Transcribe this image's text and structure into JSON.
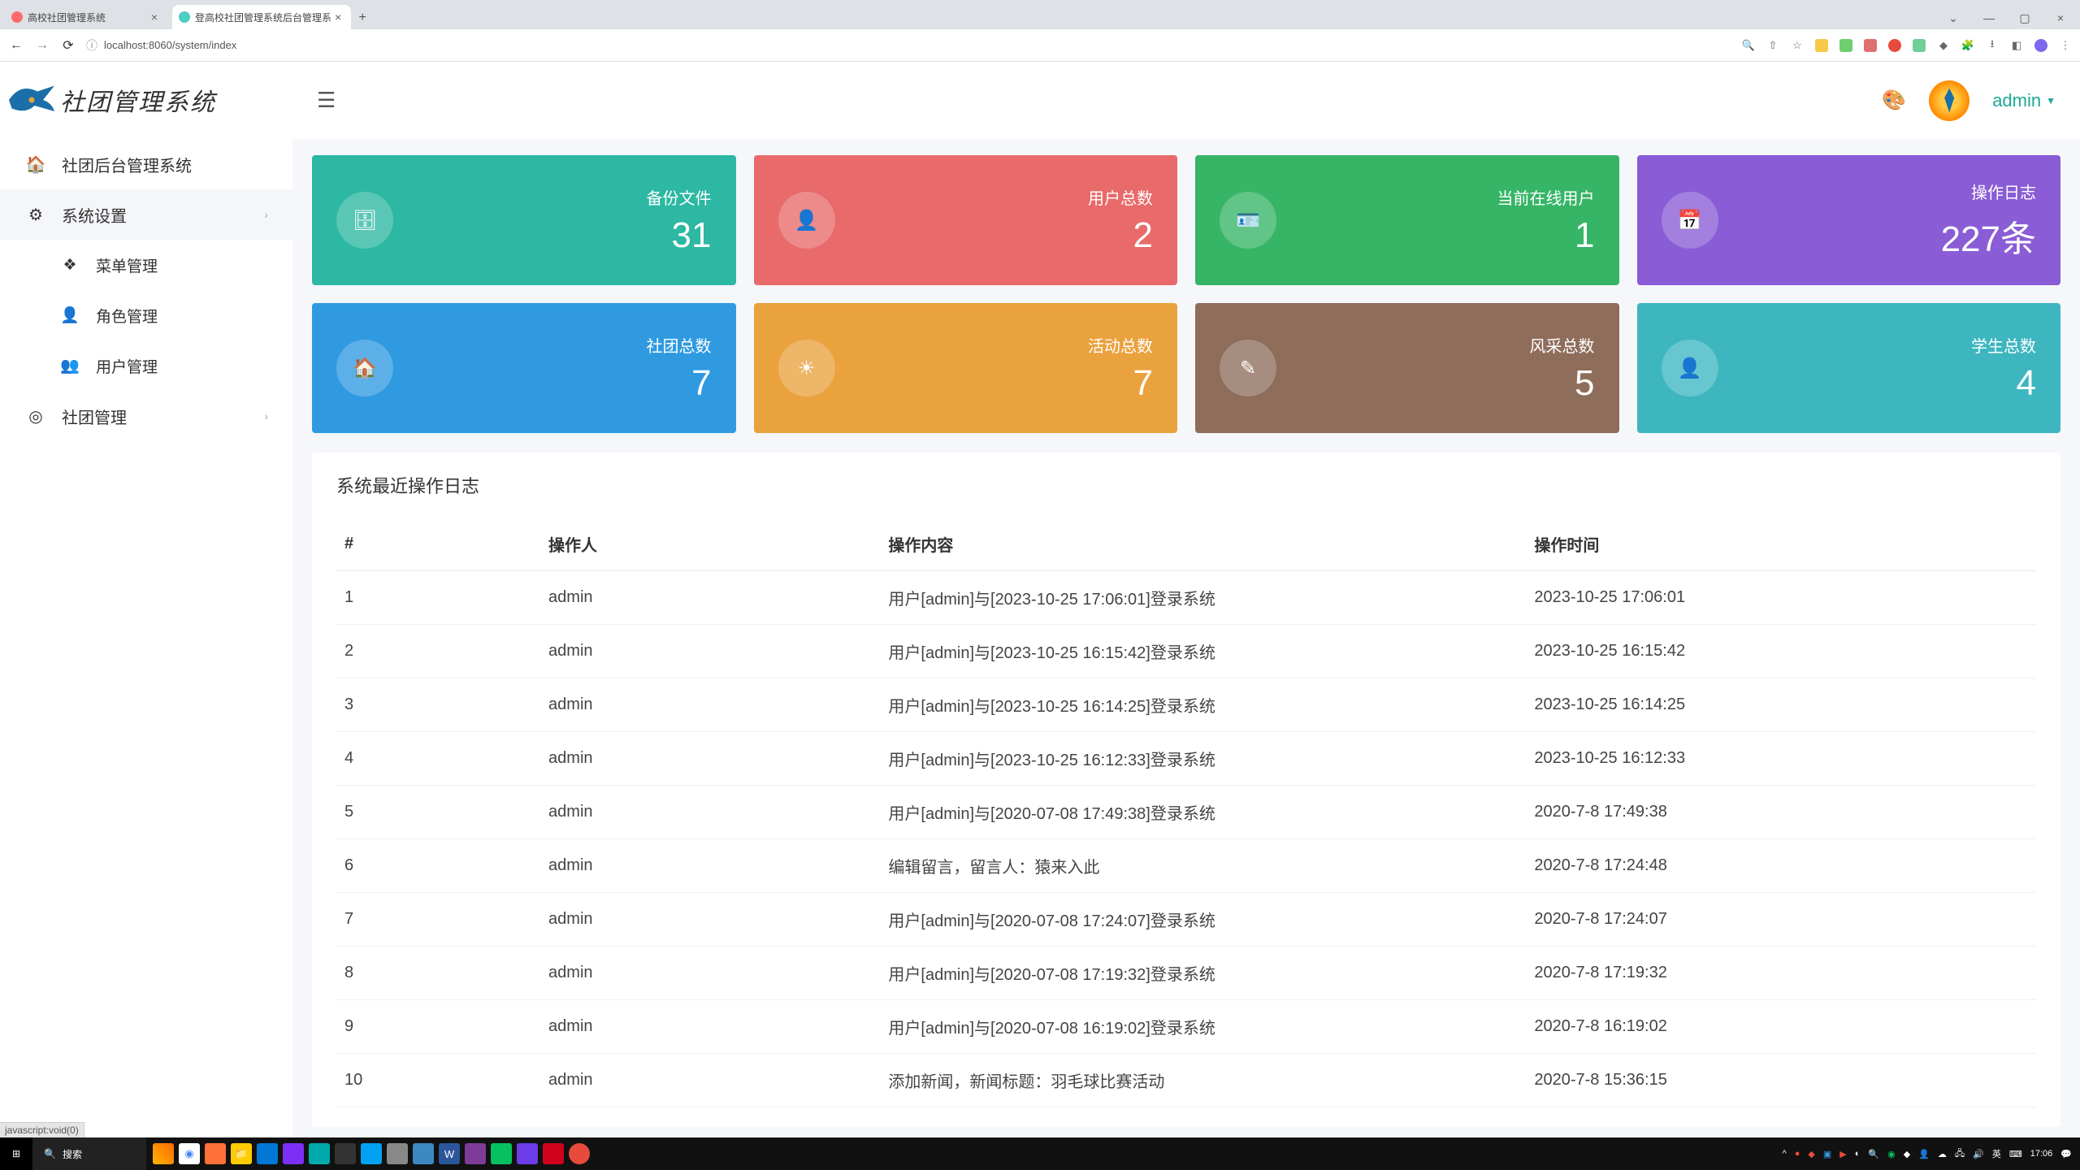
{
  "browser": {
    "tabs": [
      {
        "title": "高校社团管理系统"
      },
      {
        "title": "登高校社团管理系统后台管理系"
      }
    ],
    "url": "localhost:8060/system/index",
    "status_hint": "javascript:void(0)"
  },
  "app": {
    "logo_text": "社团管理系统",
    "hamburger_title": "menu",
    "username": "admin"
  },
  "sidebar": {
    "items": [
      {
        "icon": "home",
        "label": "社团后台管理系统"
      },
      {
        "icon": "gear",
        "label": "系统设置",
        "expandable": true
      },
      {
        "icon": "layers",
        "label": "菜单管理",
        "sub": true
      },
      {
        "icon": "user",
        "label": "角色管理",
        "sub": true
      },
      {
        "icon": "users",
        "label": "用户管理",
        "sub": true
      },
      {
        "icon": "target",
        "label": "社团管理",
        "expandable": true
      }
    ]
  },
  "cards": [
    {
      "label": "备份文件",
      "value": "31",
      "color": "#2cb8a2",
      "icon": "db"
    },
    {
      "label": "用户总数",
      "value": "2",
      "color": "#e86a6a",
      "icon": "person"
    },
    {
      "label": "当前在线用户",
      "value": "1",
      "color": "#37b567",
      "icon": "badge"
    },
    {
      "label": "操作日志",
      "value": "227条",
      "color": "#8a5cd6",
      "icon": "calendar"
    },
    {
      "label": "社团总数",
      "value": "7",
      "color": "#2f9ae0",
      "icon": "home2"
    },
    {
      "label": "活动总数",
      "value": "7",
      "color": "#eaa23e",
      "icon": "sun"
    },
    {
      "label": "风采总数",
      "value": "5",
      "color": "#8f6d5b",
      "icon": "pen"
    },
    {
      "label": "学生总数",
      "value": "4",
      "color": "#3db6c0",
      "icon": "avatar"
    }
  ],
  "log_table": {
    "title": "系统最近操作日志",
    "headers": [
      "#",
      "操作人",
      "操作内容",
      "操作时间"
    ],
    "rows": [
      [
        "1",
        "admin",
        "用户[admin]与[2023-10-25 17:06:01]登录系统",
        "2023-10-25 17:06:01"
      ],
      [
        "2",
        "admin",
        "用户[admin]与[2023-10-25 16:15:42]登录系统",
        "2023-10-25 16:15:42"
      ],
      [
        "3",
        "admin",
        "用户[admin]与[2023-10-25 16:14:25]登录系统",
        "2023-10-25 16:14:25"
      ],
      [
        "4",
        "admin",
        "用户[admin]与[2023-10-25 16:12:33]登录系统",
        "2023-10-25 16:12:33"
      ],
      [
        "5",
        "admin",
        "用户[admin]与[2020-07-08 17:49:38]登录系统",
        "2020-7-8 17:49:38"
      ],
      [
        "6",
        "admin",
        "编辑留言，留言人：猿来入此",
        "2020-7-8 17:24:48"
      ],
      [
        "7",
        "admin",
        "用户[admin]与[2020-07-08 17:24:07]登录系统",
        "2020-7-8 17:24:07"
      ],
      [
        "8",
        "admin",
        "用户[admin]与[2020-07-08 17:19:32]登录系统",
        "2020-7-8 17:19:32"
      ],
      [
        "9",
        "admin",
        "用户[admin]与[2020-07-08 16:19:02]登录系统",
        "2020-7-8 16:19:02"
      ],
      [
        "10",
        "admin",
        "添加新闻，新闻标题：羽毛球比赛活动",
        "2020-7-8 15:36:15"
      ]
    ]
  },
  "taskbar": {
    "search_placeholder": "搜索",
    "time": "17:06",
    "ime": "英"
  }
}
